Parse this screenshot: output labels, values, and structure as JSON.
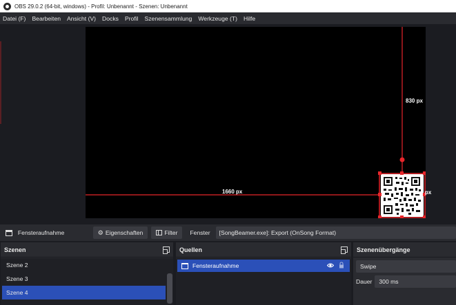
{
  "window": {
    "title": "OBS 29.0.2 (64-bit, windows) - Profil: Unbenannt - Szenen: Unbenannt"
  },
  "menu": [
    "Datei (F)",
    "Bearbeiten",
    "Ansicht (V)",
    "Docks",
    "Profil",
    "Szenensammlung",
    "Werkzeuge (T)",
    "Hilfe"
  ],
  "preview": {
    "width_label": "1660 px",
    "height_label": "830 px",
    "edge_label": "px",
    "guide_color": "#e8262b"
  },
  "source_toolbar": {
    "source_name": "Fensteraufnahme",
    "properties_label": "Eigenschaften",
    "filter_label": "Filter",
    "window_label": "Fenster",
    "window_value": "[SongBeamer.exe]: Export (OnSong Format)"
  },
  "scenes": {
    "title": "Szenen",
    "items": [
      "Szene 2",
      "Szene 3",
      "Szene 4"
    ],
    "active_index": 2
  },
  "sources": {
    "title": "Quellen",
    "items": [
      {
        "name": "Fensteraufnahme"
      }
    ]
  },
  "transitions": {
    "title": "Szenenübergänge",
    "selected": "Swipe",
    "duration_label": "Dauer",
    "duration_value": "300 ms"
  },
  "colors": {
    "accent": "#2b50b8",
    "guide": "#e8262b"
  }
}
